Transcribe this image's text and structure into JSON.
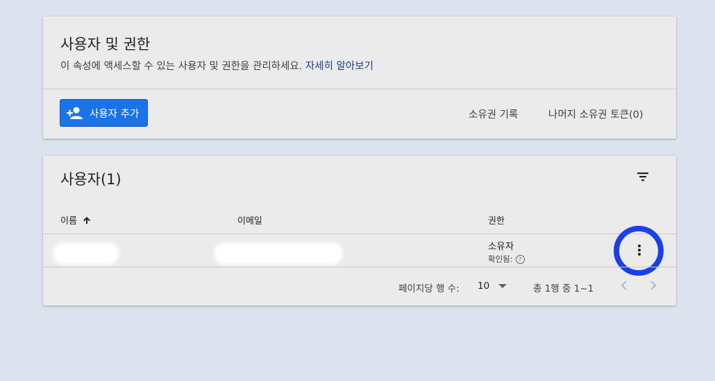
{
  "permissions_card": {
    "title": "사용자 및 권한",
    "description": "이 속성에 액세스할 수 있는 사용자 및 권한을 관리하세요.",
    "learn_more": "자세히 알아보기",
    "add_user_label": "사용자 추가",
    "ownership_history_label": "소유권 기록",
    "remaining_tokens_label": "나머지 소유권 토큰(0)"
  },
  "users_card": {
    "title": "사용자(1)",
    "columns": {
      "name": "이름",
      "email": "이메일",
      "role": "권한"
    },
    "rows": [
      {
        "name": "",
        "email": "",
        "role": "소유자",
        "status": "확인됨:"
      }
    ],
    "pagination": {
      "rows_per_page_label": "페이지당 행 수:",
      "rows_per_page_value": "10",
      "range_text": "총 1행 중 1~1"
    }
  },
  "colors": {
    "primary_button": "#1a73e8",
    "link": "#1a3f86",
    "highlight_ring": "#1b3fe8",
    "background": "#dce3ee",
    "card": "#ebebeb"
  },
  "icons": [
    "person-add-icon",
    "filter-icon",
    "sort-arrow-up-icon",
    "help-icon",
    "more-vert-icon",
    "dropdown-arrow-icon",
    "chevron-left-icon",
    "chevron-right-icon"
  ]
}
